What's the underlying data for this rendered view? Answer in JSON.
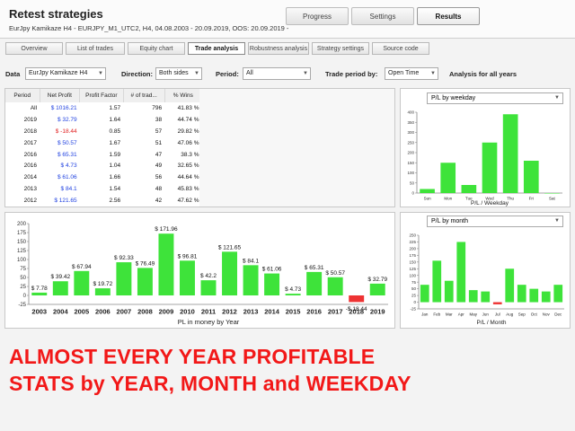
{
  "header": {
    "title": "Retest strategies",
    "subtitle": "EurJpy Kamikaze H4 - EURJPY_M1_UTC2, H4, 04.08.2003 - 20.09.2019, OOS: 20.09.2019 -",
    "buttons": [
      "Progress",
      "Settings",
      "Results"
    ],
    "active_button": "Results"
  },
  "tabs": [
    "Overview",
    "List of trades",
    "Equity chart",
    "Trade analysis",
    "Robustness analysis",
    "Strategy settings",
    "Source code"
  ],
  "active_tab": "Trade analysis",
  "filters": {
    "data_label": "Data",
    "data_value": "EurJpy Kamikaze H4",
    "direction_label": "Direction:",
    "direction_value": "Both sides",
    "period_label": "Period:",
    "period_value": "All",
    "trade_period_label": "Trade period by:",
    "trade_period_value": "Open Time",
    "analysis_label": "Analysis for all years"
  },
  "year_table": {
    "columns": [
      "Period",
      "Net Profit",
      "Profit Factor",
      "# of trad...",
      "% Wins"
    ],
    "rows": [
      {
        "period": "All",
        "net": "$ 1016.21",
        "pf": "1.57",
        "trades": "796",
        "wins": "41.83 %",
        "neg": false
      },
      {
        "period": "2019",
        "net": "$ 32.79",
        "pf": "1.64",
        "trades": "38",
        "wins": "44.74 %",
        "neg": false
      },
      {
        "period": "2018",
        "net": "$ -18.44",
        "pf": "0.85",
        "trades": "57",
        "wins": "29.82 %",
        "neg": true
      },
      {
        "period": "2017",
        "net": "$ 50.57",
        "pf": "1.67",
        "trades": "51",
        "wins": "47.06 %",
        "neg": false
      },
      {
        "period": "2016",
        "net": "$ 65.31",
        "pf": "1.59",
        "trades": "47",
        "wins": "38.3 %",
        "neg": false
      },
      {
        "period": "2016",
        "net": "$ 4.73",
        "pf": "1.04",
        "trades": "49",
        "wins": "32.65 %",
        "neg": false
      },
      {
        "period": "2014",
        "net": "$ 61.06",
        "pf": "1.66",
        "trades": "56",
        "wins": "44.64 %",
        "neg": false
      },
      {
        "period": "2013",
        "net": "$ 84.1",
        "pf": "1.54",
        "trades": "48",
        "wins": "45.83 %",
        "neg": false
      },
      {
        "period": "2012",
        "net": "$ 121.65",
        "pf": "2.56",
        "trades": "42",
        "wins": "47.62 %",
        "neg": false
      }
    ]
  },
  "weekday_panel": {
    "select": "P/L by weekday"
  },
  "month_panel": {
    "select": "P/L by month"
  },
  "promo": {
    "line1": "ALMOST EVERY YEAR PROFITABLE",
    "line2": "STATS by YEAR, MONTH and WEEKDAY"
  },
  "colors": {
    "bar": "#3ee33a",
    "bar_negative": "#ee3333",
    "promo": "#f21818",
    "positive_text": "#1d3fe0"
  },
  "chart_data": [
    {
      "type": "bar",
      "categories": [
        "2003",
        "2004",
        "2005",
        "2006",
        "2007",
        "2008",
        "2009",
        "2010",
        "2011",
        "2012",
        "2013",
        "2014",
        "2015",
        "2016",
        "2017",
        "2018",
        "2019"
      ],
      "values": [
        7.78,
        39.42,
        67.94,
        19.72,
        92.33,
        76.49,
        171.96,
        96.81,
        42.2,
        121.65,
        84.1,
        61.06,
        4.73,
        65.31,
        50.57,
        -18.44,
        32.79
      ],
      "data_labels": [
        "$ 7.78",
        "$ 39.42",
        "$ 67.94",
        "$ 19.72",
        "$ 92.33",
        "$ 76.49",
        "$ 171.96",
        "$ 96.81",
        "$ 42.2",
        "$ 121.65",
        "$ 84.1",
        "$ 61.06",
        "$ 4.73",
        "$ 65.31",
        "$ 50.57",
        "-$ 18.44",
        "$ 32.79"
      ],
      "xlabel": "PL in money by Year",
      "ylim": [
        -25,
        200
      ],
      "yticks": [
        -25,
        0,
        25,
        50,
        75,
        100,
        125,
        150,
        175,
        200
      ],
      "grid": false
    },
    {
      "type": "bar",
      "categories": [
        "Sun",
        "Mon",
        "Tue",
        "Wed",
        "Thu",
        "Fri",
        "Sat"
      ],
      "values": [
        20,
        150,
        40,
        250,
        390,
        160,
        0
      ],
      "xlabel": "P/L / Weekday",
      "ylim": [
        0,
        400
      ],
      "yticks": [
        0,
        50,
        100,
        150,
        200,
        250,
        300,
        350,
        400
      ]
    },
    {
      "type": "bar",
      "categories": [
        "Jan",
        "Feb",
        "Mar",
        "Apr",
        "May",
        "Jun",
        "Jul",
        "Aug",
        "Sep",
        "Oct",
        "Nov",
        "Dec"
      ],
      "values": [
        65,
        155,
        80,
        225,
        45,
        40,
        -8,
        125,
        65,
        50,
        40,
        65
      ],
      "xlabel": "P/L / Month",
      "ylim": [
        -25,
        250
      ],
      "yticks": [
        -25,
        0,
        25,
        50,
        75,
        100,
        125,
        150,
        175,
        200,
        225,
        250
      ]
    }
  ]
}
